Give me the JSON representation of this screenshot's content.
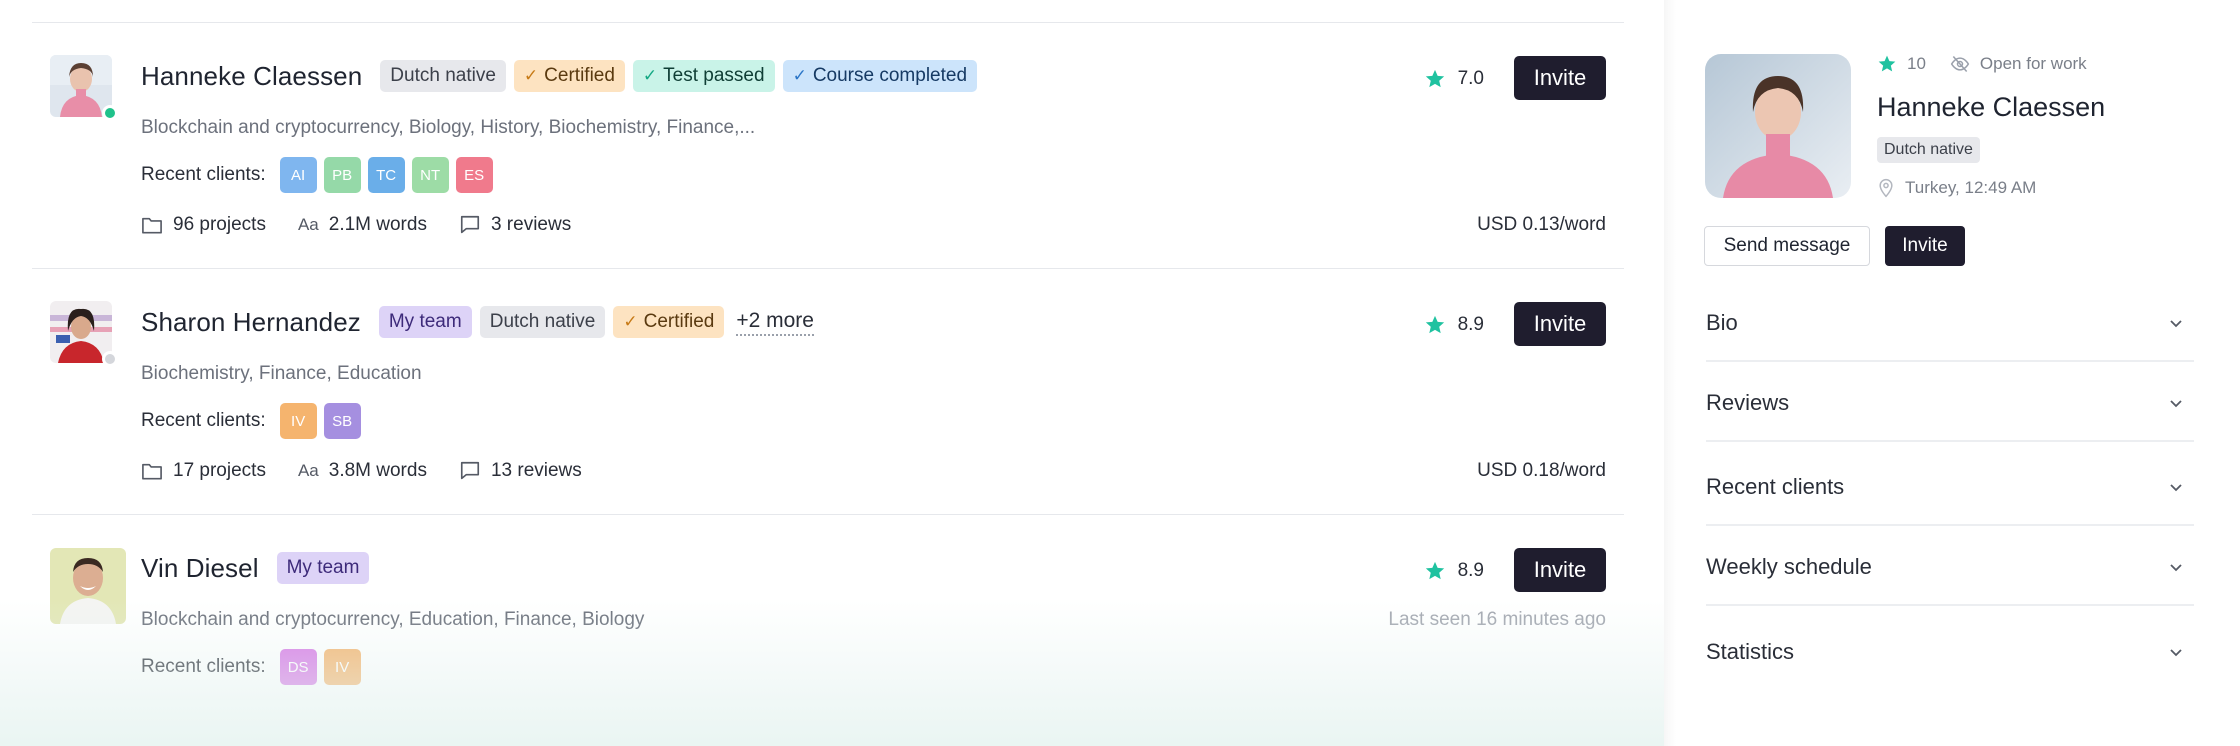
{
  "translators": [
    {
      "name": "Hanneke Claessen",
      "online": true,
      "tags": [
        {
          "label": "Dutch native",
          "style": "gray",
          "check": false
        },
        {
          "label": "Certified",
          "style": "orange",
          "check": true
        },
        {
          "label": "Test passed",
          "style": "teal",
          "check": true
        },
        {
          "label": "Course completed",
          "style": "blue",
          "check": true
        }
      ],
      "more": "",
      "rating": "7.0",
      "invite_label": "Invite",
      "skills": "Blockchain and cryptocurrency, Biology, History, Biochemistry, Finance,...",
      "last_seen": "",
      "recent_clients_label": "Recent clients:",
      "clients": [
        {
          "initials": "AI",
          "color": "#7fb6ef"
        },
        {
          "initials": "PB",
          "color": "#95d9a8"
        },
        {
          "initials": "TC",
          "color": "#6aaee9"
        },
        {
          "initials": "NT",
          "color": "#9ddca6"
        },
        {
          "initials": "ES",
          "color": "#f07a8c"
        }
      ],
      "projects": "96 projects",
      "words": "2.1M words",
      "reviews": "3 reviews",
      "price": "USD 0.13/word"
    },
    {
      "name": "Sharon Hernandez",
      "online": false,
      "tags": [
        {
          "label": "My team",
          "style": "purple",
          "check": false
        },
        {
          "label": "Dutch native",
          "style": "gray",
          "check": false
        },
        {
          "label": "Certified",
          "style": "orange",
          "check": true
        }
      ],
      "more": "+2 more",
      "rating": "8.9",
      "invite_label": "Invite",
      "skills": "Biochemistry, Finance, Education",
      "last_seen": "",
      "recent_clients_label": "Recent clients:",
      "clients": [
        {
          "initials": "IV",
          "color": "#f5b46e"
        },
        {
          "initials": "SB",
          "color": "#a58fe0"
        }
      ],
      "projects": "17 projects",
      "words": "3.8M words",
      "reviews": "13 reviews",
      "price": "USD 0.18/word"
    },
    {
      "name": "Vin Diesel",
      "online": null,
      "tags": [
        {
          "label": "My team",
          "style": "purple",
          "check": false
        }
      ],
      "more": "",
      "rating": "8.9",
      "invite_label": "Invite",
      "skills": "Blockchain and cryptocurrency, Education, Finance, Biology",
      "last_seen": "Last seen 16 minutes ago",
      "recent_clients_label": "Recent clients:",
      "clients": [
        {
          "initials": "DS",
          "color": "#d778e6"
        },
        {
          "initials": "IV",
          "color": "#f5b46e"
        }
      ],
      "projects": "",
      "words": "",
      "reviews": "",
      "price": ""
    }
  ],
  "words_icon_text": "Aa",
  "profile": {
    "rating": "10",
    "availability": "Open for work",
    "name": "Hanneke Claessen",
    "tag": "Dutch native",
    "location": "Turkey, 12:49 AM",
    "send_message_label": "Send message",
    "invite_label": "Invite",
    "sections": [
      "Bio",
      "Reviews",
      "Recent clients",
      "Weekly schedule",
      "Statistics"
    ]
  },
  "colors": {
    "accent_dark": "#1f1d2e",
    "star": "#1fc2a0",
    "online": "#1fc28b"
  }
}
